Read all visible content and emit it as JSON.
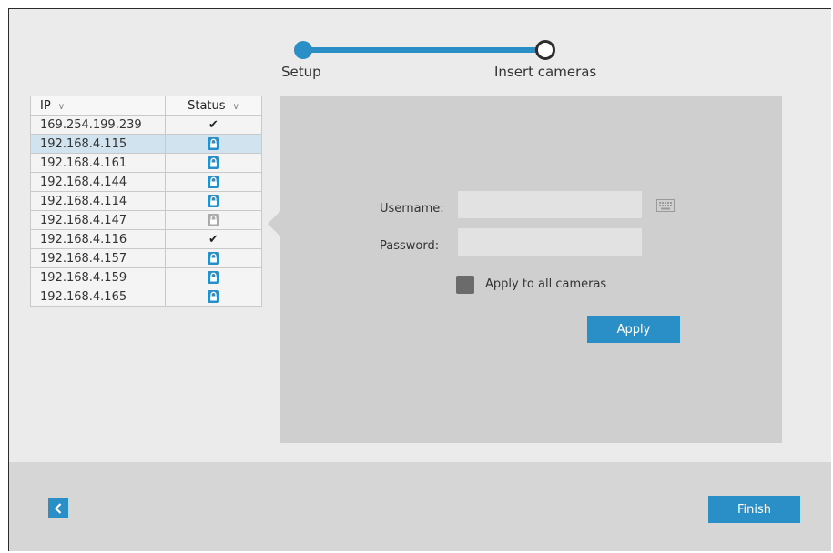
{
  "stepper": {
    "steps": [
      {
        "label": "Setup",
        "state": "done"
      },
      {
        "label": "Insert cameras",
        "state": "current"
      }
    ]
  },
  "camera_table": {
    "columns": {
      "ip": "IP",
      "status": "Status"
    },
    "rows": [
      {
        "ip": "169.254.199.239",
        "status": "connected"
      },
      {
        "ip": "192.168.4.115",
        "status": "locked",
        "selected": true
      },
      {
        "ip": "192.168.4.161",
        "status": "locked"
      },
      {
        "ip": "192.168.4.144",
        "status": "locked"
      },
      {
        "ip": "192.168.4.114",
        "status": "locked"
      },
      {
        "ip": "192.168.4.147",
        "status": "locked-disabled"
      },
      {
        "ip": "192.168.4.116",
        "status": "connected"
      },
      {
        "ip": "192.168.4.157",
        "status": "locked"
      },
      {
        "ip": "192.168.4.159",
        "status": "locked"
      },
      {
        "ip": "192.168.4.165",
        "status": "locked"
      }
    ]
  },
  "login": {
    "username_label": "Username:",
    "password_label": "Password:",
    "username_value": "",
    "password_value": "",
    "apply_all_label": "Apply to all cameras",
    "apply_all_checked": false,
    "apply_label": "Apply"
  },
  "footer": {
    "finish_label": "Finish"
  },
  "colors": {
    "accent": "#2b8fc7",
    "lock_disabled": "#aaaaaa",
    "panel": "#cfcfcf",
    "selected_row": "#d1e3ee"
  },
  "icons": {
    "back": "chevron-left-icon",
    "keyboard": "keyboard-icon",
    "lock": "lock-icon",
    "check": "check-icon",
    "sort": "chevron-down-icon"
  }
}
